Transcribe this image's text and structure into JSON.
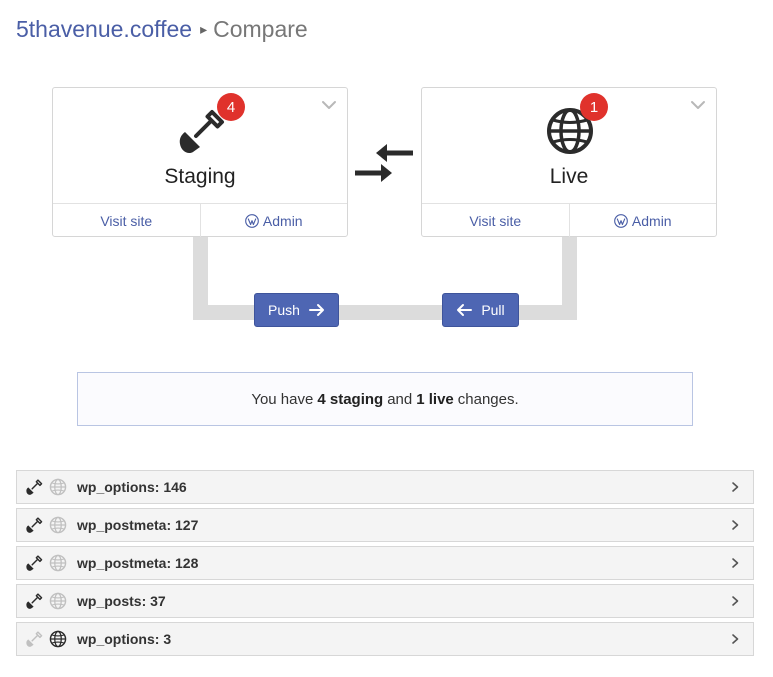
{
  "breadcrumb": {
    "site": "5thavenue.coffee",
    "separator": "▸",
    "page": "Compare"
  },
  "environments": {
    "staging": {
      "title": "Staging",
      "badge": "4",
      "icon": "shovel-icon",
      "visit_label": "Visit site",
      "admin_label": "Admin"
    },
    "live": {
      "title": "Live",
      "badge": "1",
      "icon": "globe-icon",
      "visit_label": "Visit site",
      "admin_label": "Admin"
    }
  },
  "actions": {
    "push_label": "Push",
    "pull_label": "Pull"
  },
  "summary": {
    "prefix": "You have",
    "staging_count": "4 staging",
    "conjunction": "and",
    "live_count": "1 live",
    "suffix": "changes."
  },
  "tables": [
    {
      "label": "wp_options: 146",
      "env": "staging"
    },
    {
      "label": "wp_postmeta: 127",
      "env": "staging"
    },
    {
      "label": "wp_postmeta: 128",
      "env": "staging"
    },
    {
      "label": "wp_posts: 37",
      "env": "staging"
    },
    {
      "label": "wp_options: 3",
      "env": "live"
    }
  ],
  "colors": {
    "accent": "#4e66b3",
    "badge": "#e0322c",
    "link": "#4a5ea6",
    "pipe": "#dcdcdc"
  }
}
